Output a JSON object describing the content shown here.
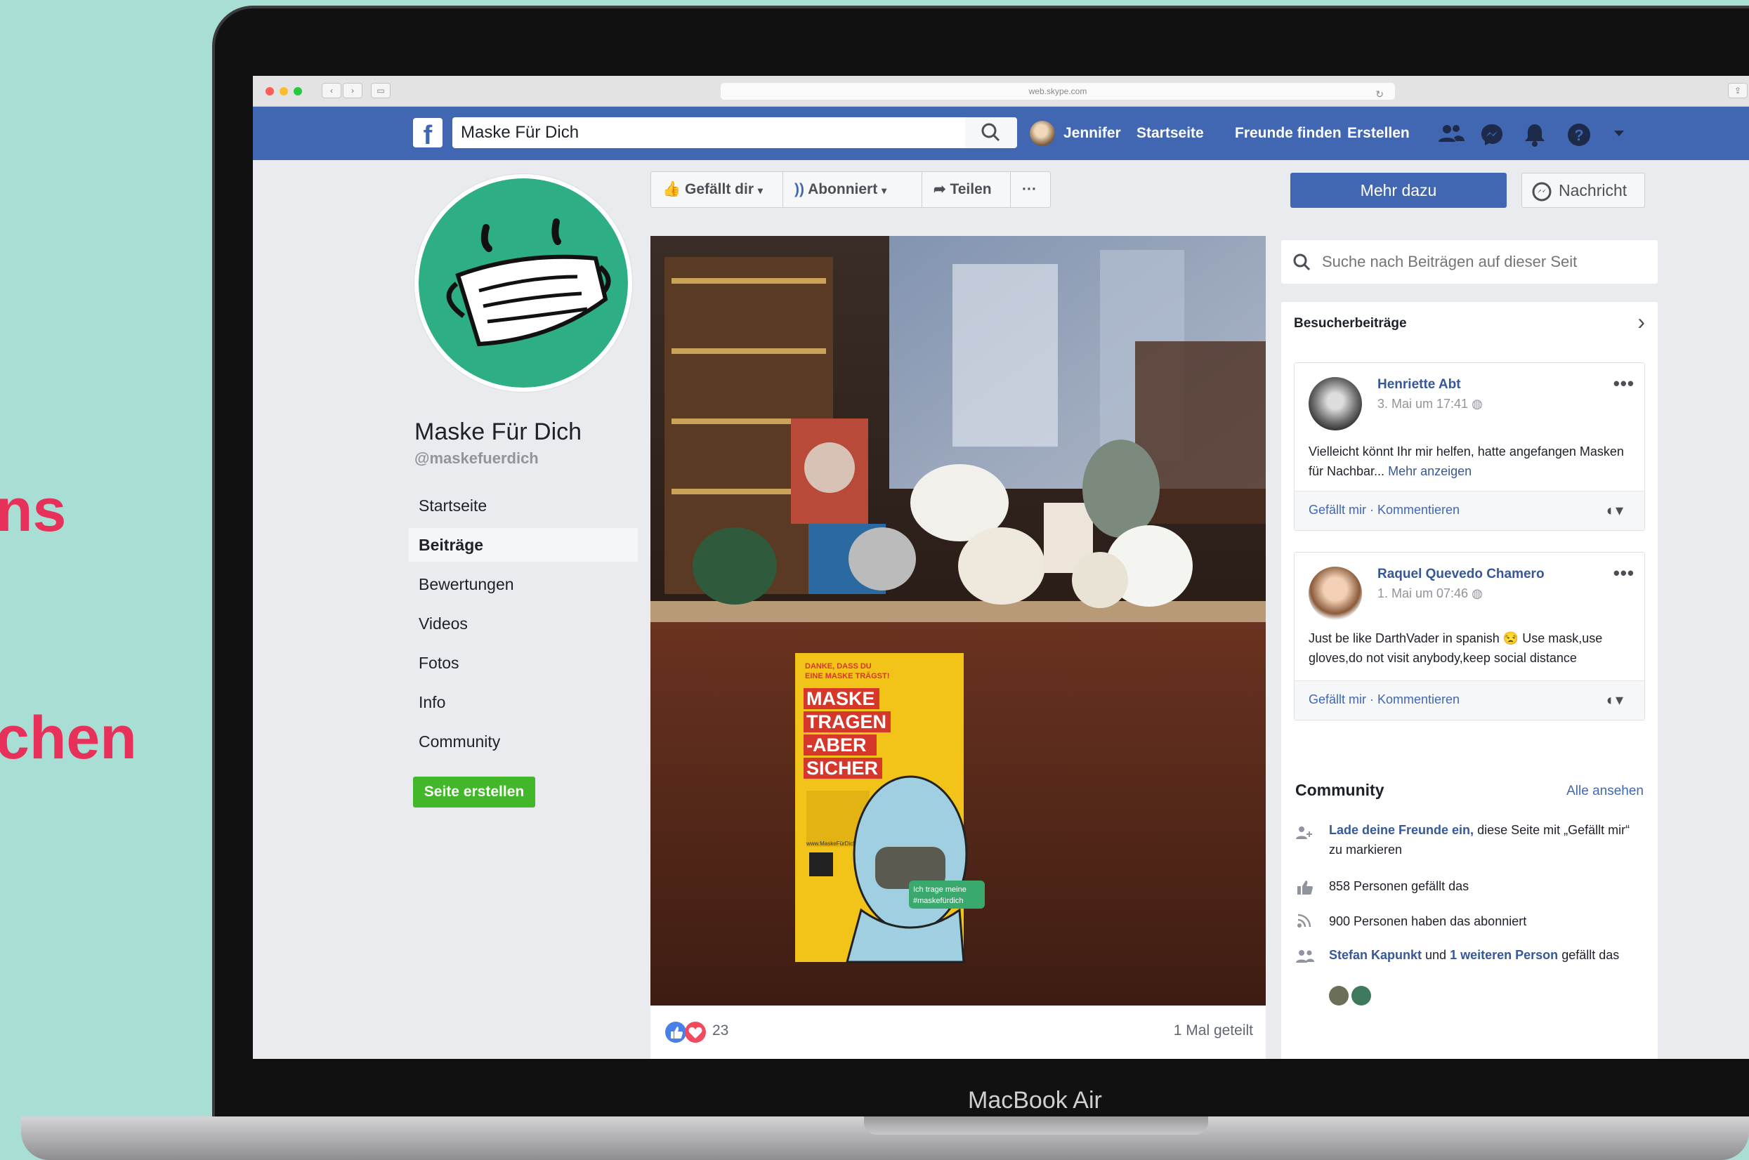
{
  "background_text": [
    "ns",
    "chen"
  ],
  "device_label": "MacBook Air",
  "browser": {
    "url": "web.skype.com"
  },
  "topbar": {
    "logo": "f",
    "search_value": "Maske Für Dich",
    "user_name": "Jennifer",
    "links": [
      "Startseite",
      "Freunde finden",
      "Erstellen"
    ],
    "icons": [
      "friends-icon",
      "messenger-icon",
      "bell-icon",
      "help-icon",
      "caret-down-icon"
    ]
  },
  "page": {
    "name": "Maske Für Dich",
    "handle": "@maskefuerdich",
    "nav": [
      "Startseite",
      "Beiträge",
      "Bewertungen",
      "Videos",
      "Fotos",
      "Info",
      "Community"
    ],
    "active_nav": "Beiträge",
    "create_button": "Seite erstellen"
  },
  "actions": {
    "like": "Gefällt dir",
    "follow": "Abonniert",
    "share": "Teilen",
    "more": "···"
  },
  "header_buttons": {
    "more_info": "Mehr dazu",
    "message": "Nachricht"
  },
  "post": {
    "poster_lines": [
      "DANKE, DASS DU",
      "EINE MASKE TRÄGST!",
      "MASKE",
      "TRAGEN",
      "-ABER",
      "SICHER",
      "www.MaskeFürDich.de",
      "Ich trage meine",
      "#maskefürdich"
    ],
    "reaction_count": "23",
    "shares": "1 Mal geteilt"
  },
  "right": {
    "search_placeholder": "Suche nach Beiträgen auf dieser Seit",
    "visitor_title": "Besucherbeiträge",
    "visitor_posts": [
      {
        "name": "Henriette Abt",
        "date": "3. Mai um 17:41",
        "text": "Vielleicht könnt Ihr mir helfen, hatte angefangen Masken für Nachbar...",
        "more": "Mehr anzeigen",
        "footer": "Gefällt mir · Kommentieren"
      },
      {
        "name": "Raquel Quevedo Chamero",
        "date": "1. Mai um 07:46",
        "text": "Just be like DarthVader in spanish 😒 Use mask,use gloves,do not visit anybody,keep social distance",
        "footer": "Gefällt mir · Kommentieren"
      }
    ],
    "community": {
      "title": "Community",
      "see_all": "Alle ansehen",
      "invite_link": "Lade deine Freunde ein,",
      "invite_rest": "diese Seite mit „Gefällt mir“ zu markieren",
      "likes": "858 Personen gefällt das",
      "followers": "900 Personen haben das abonniert",
      "friend_name": "Stefan Kapunkt",
      "friend_and": "und",
      "friend_more": "1 weiteren Person",
      "friend_rest": "gefällt das"
    }
  },
  "colors": {
    "facebook_blue": "#4267b2",
    "green": "#42b72a",
    "accent_pink": "#e8315a",
    "mask_green": "#2eae84"
  }
}
